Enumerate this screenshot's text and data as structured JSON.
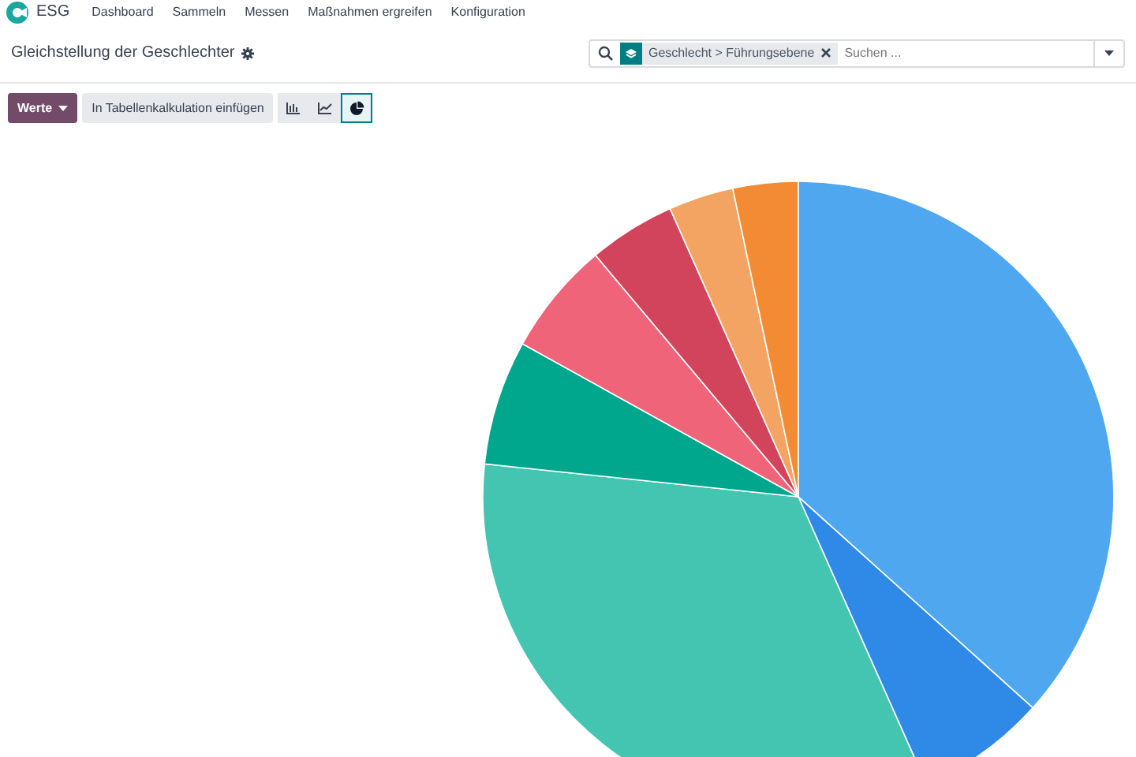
{
  "navbar": {
    "app_name": "ESG",
    "menu": [
      {
        "label": "Dashboard"
      },
      {
        "label": "Sammeln"
      },
      {
        "label": "Messen"
      },
      {
        "label": "Maßnahmen ergreifen"
      },
      {
        "label": "Konfiguration"
      }
    ]
  },
  "header": {
    "title": "Gleichstellung der Geschlechter"
  },
  "search": {
    "facet": "Geschlecht > Führungsebene",
    "placeholder": "Suchen ..."
  },
  "toolbar": {
    "measures_button": "Werte",
    "insert_button": "In Tabellenkalkulation einfügen",
    "views": [
      {
        "kind": "bar",
        "selected": false
      },
      {
        "kind": "line",
        "selected": false
      },
      {
        "kind": "pie",
        "selected": true
      }
    ]
  }
}
